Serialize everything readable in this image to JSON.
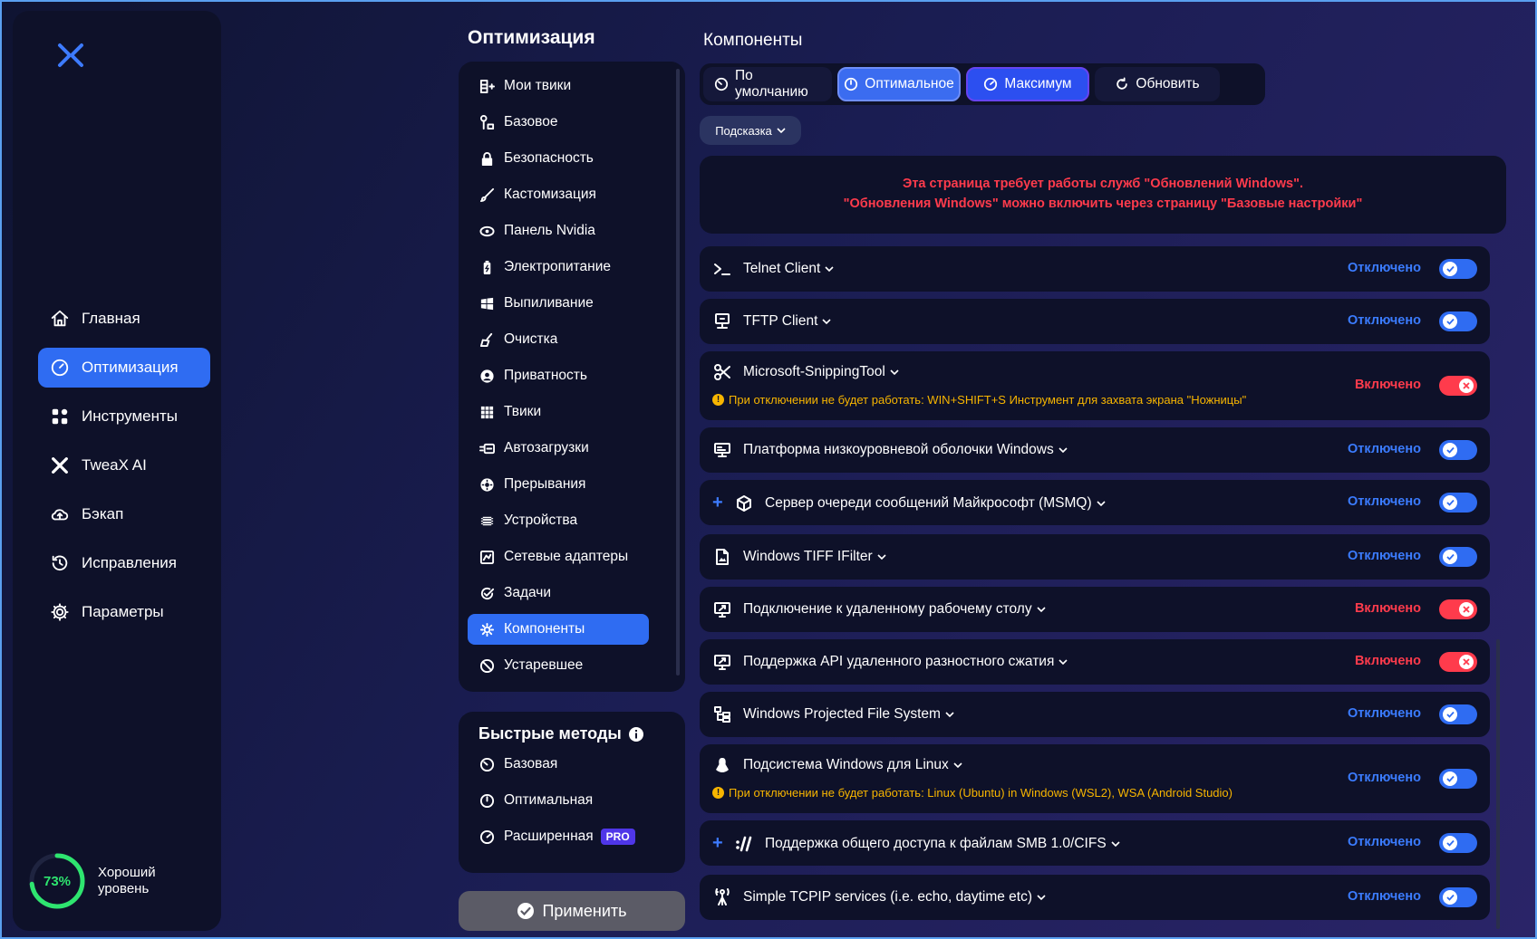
{
  "nav": {
    "items": [
      {
        "label": "Главная",
        "icon": "home-icon",
        "active": false
      },
      {
        "label": "Оптимизация",
        "icon": "gauge-icon",
        "active": true
      },
      {
        "label": "Инструменты",
        "icon": "grid-icon",
        "active": false
      },
      {
        "label": "TweaX AI",
        "icon": "ai-icon",
        "active": false
      },
      {
        "label": "Бэкап",
        "icon": "cloud-icon",
        "active": false
      },
      {
        "label": "Исправления",
        "icon": "history-icon",
        "active": false
      },
      {
        "label": "Параметры",
        "icon": "gear-icon",
        "active": false
      }
    ],
    "score_value": "73%",
    "score_percent": 73,
    "score_label": "Хороший уровень"
  },
  "middle": {
    "title": "Оптимизация",
    "items": [
      {
        "label": "Мои твики",
        "icon": "my-tweaks-icon"
      },
      {
        "label": "Базовое",
        "icon": "wrench-icon"
      },
      {
        "label": "Безопасность",
        "icon": "lock-icon"
      },
      {
        "label": "Кастомизация",
        "icon": "brush-icon"
      },
      {
        "label": "Панель Nvidia",
        "icon": "nvidia-icon"
      },
      {
        "label": "Электропитание",
        "icon": "battery-icon"
      },
      {
        "label": "Выпиливание",
        "icon": "windows-icon"
      },
      {
        "label": "Очистка",
        "icon": "broom-icon"
      },
      {
        "label": "Приватность",
        "icon": "privacy-icon"
      },
      {
        "label": "Твики",
        "icon": "tweaks-grid-icon"
      },
      {
        "label": "Автозагрузки",
        "icon": "autostart-icon"
      },
      {
        "label": "Прерывания",
        "icon": "interrupt-icon"
      },
      {
        "label": "Устройства",
        "icon": "chip-icon"
      },
      {
        "label": "Сетевые адаптеры",
        "icon": "network-icon"
      },
      {
        "label": "Задачи",
        "icon": "tasks-icon"
      },
      {
        "label": "Компоненты",
        "icon": "components-icon"
      },
      {
        "label": "Устаревшее",
        "icon": "deprecated-icon"
      }
    ],
    "active_index": 15,
    "quick": {
      "title": "Быстрые методы",
      "items": [
        {
          "label": "Базовая",
          "icon": "gauge-low-icon"
        },
        {
          "label": "Оптимальная",
          "icon": "gauge-mid-icon"
        },
        {
          "label": "Расширенная",
          "icon": "gauge-high-icon",
          "badge": "PRO"
        }
      ]
    },
    "apply_label": "Применить"
  },
  "right": {
    "title": "Компоненты",
    "presets": [
      {
        "label": "По умолчанию",
        "icon": "gauge-low-icon",
        "style": "default"
      },
      {
        "label": "Оптимальное",
        "icon": "gauge-mid-icon",
        "style": "opt"
      },
      {
        "label": "Максимум",
        "icon": "gauge-high-icon",
        "style": "max"
      },
      {
        "label": "Обновить",
        "icon": "refresh-icon",
        "style": "default"
      }
    ],
    "hint_label": "Подсказка",
    "notice_line1": "Эта страница требует работы служб \"Обновлений Windows\".",
    "notice_line2": "\"Обновления Windows\" можно включить через страницу \"Базовые настройки\"",
    "components": [
      {
        "name": "Telnet Client",
        "icon": "terminal-icon",
        "status": "Отключено",
        "state": "off",
        "plus": false,
        "warning": ""
      },
      {
        "name": "TFTP Client",
        "icon": "monitor-network-icon",
        "status": "Отключено",
        "state": "off",
        "plus": false,
        "warning": ""
      },
      {
        "name": "Microsoft-SnippingTool",
        "icon": "scissors-icon",
        "status": "Включено",
        "state": "on",
        "plus": false,
        "warning": "При отключении не будет работать: WIN+SHIFT+S Инструмент для захвата экрана \"Ножницы\""
      },
      {
        "name": "Платформа низкоуровневой оболочки Windows",
        "icon": "hypervisor-icon",
        "status": "Отключено",
        "state": "off",
        "plus": false,
        "warning": ""
      },
      {
        "name": "Сервер очереди сообщений Майкрософт (MSMQ)",
        "icon": "cube-icon",
        "status": "Отключено",
        "state": "off",
        "plus": true,
        "warning": ""
      },
      {
        "name": "Windows TIFF IFilter",
        "icon": "image-file-icon",
        "status": "Отключено",
        "state": "off",
        "plus": false,
        "warning": ""
      },
      {
        "name": "Подключение к удаленному рабочему столу",
        "icon": "remote-desktop-icon",
        "status": "Включено",
        "state": "on",
        "plus": false,
        "warning": ""
      },
      {
        "name": "Поддержка API удаленного разностного сжатия",
        "icon": "remote-desktop-icon",
        "status": "Включено",
        "state": "on",
        "plus": false,
        "warning": ""
      },
      {
        "name": "Windows Projected File System",
        "icon": "file-tree-icon",
        "status": "Отключено",
        "state": "off",
        "plus": false,
        "warning": ""
      },
      {
        "name": "Подсистема Windows для Linux",
        "icon": "linux-icon",
        "status": "Отключено",
        "state": "off",
        "plus": false,
        "warning": "При отключении не будет работать: Linux (Ubuntu) in Windows (WSL2), WSA (Android Studio)"
      },
      {
        "name": "Поддержка общего доступа к файлам SMB 1.0/CIFS",
        "icon": "smb-icon",
        "status": "Отключено",
        "state": "off",
        "plus": true,
        "warning": ""
      },
      {
        "name": "Simple TCPIP services (i.e. echo, daytime etc)",
        "icon": "antenna-icon",
        "status": "Отключено",
        "state": "off",
        "plus": false,
        "warning": ""
      }
    ]
  },
  "colors": {
    "accent": "#2f6cf2",
    "danger": "#ff3b4c",
    "warning": "#f7b500",
    "panel": "#0e1129",
    "score": "#2ee56f"
  }
}
